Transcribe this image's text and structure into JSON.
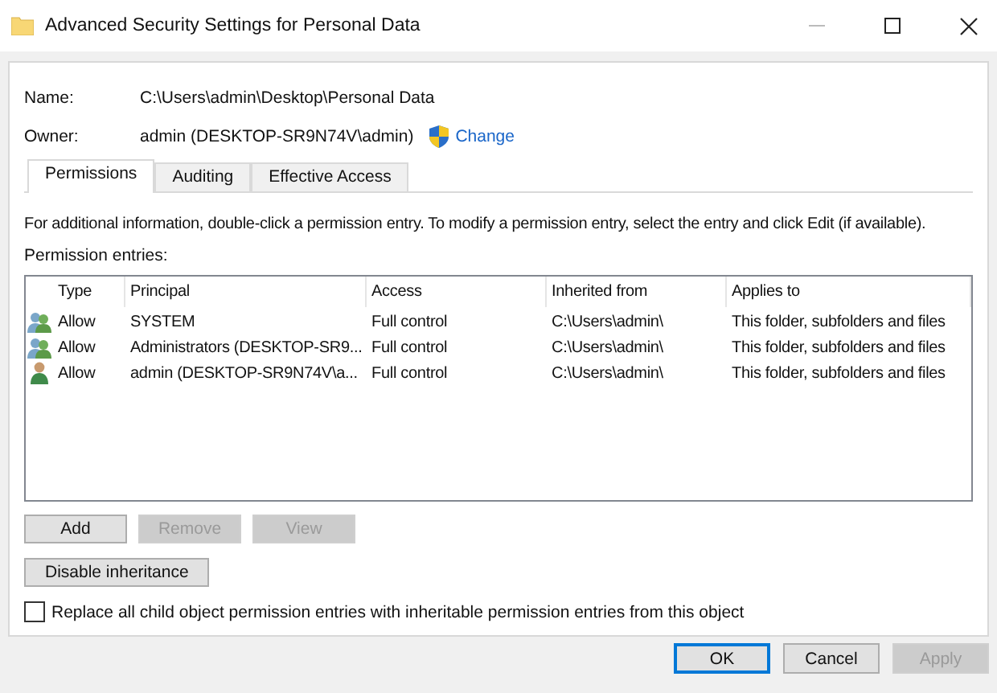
{
  "window": {
    "title": "Advanced Security Settings for Personal Data"
  },
  "name": {
    "label": "Name:",
    "value": "C:\\Users\\admin\\Desktop\\Personal Data"
  },
  "owner": {
    "label": "Owner:",
    "value": "admin (DESKTOP-SR9N74V\\admin)",
    "link": "Change"
  },
  "tabs": [
    {
      "label": "Permissions",
      "selected": true
    },
    {
      "label": "Auditing",
      "selected": false
    },
    {
      "label": "Effective Access",
      "selected": false
    }
  ],
  "info": "For additional information, double-click a permission entry. To modify a permission entry, select the entry and click Edit (if available).",
  "entries_label": "Permission entries:",
  "table": {
    "columns": [
      "Type",
      "Principal",
      "Access",
      "Inherited from",
      "Applies to"
    ],
    "rows": [
      {
        "kind": "group",
        "cells": [
          "Allow",
          "SYSTEM",
          "Full control",
          "C:\\Users\\admin\\",
          "This folder, subfolders and files"
        ]
      },
      {
        "kind": "group",
        "cells": [
          "Allow",
          "Administrators (DESKTOP-SR9...",
          "Full control",
          "C:\\Users\\admin\\",
          "This folder, subfolders and files"
        ]
      },
      {
        "kind": "user",
        "cells": [
          "Allow",
          "admin (DESKTOP-SR9N74V\\a...",
          "Full control",
          "C:\\Users\\admin\\",
          "This folder, subfolders and files"
        ]
      }
    ]
  },
  "entry_buttons": [
    {
      "label": "Add",
      "disabled": false
    },
    {
      "label": "Remove",
      "disabled": true
    },
    {
      "label": "View",
      "disabled": true
    }
  ],
  "inheritance_button": "Disable inheritance",
  "replace_checkbox": {
    "label": "Replace all child object permission entries with inheritable permission entries from this object",
    "checked": false
  },
  "dialog_buttons": [
    {
      "label": "OK",
      "disabled": false,
      "default": true
    },
    {
      "label": "Cancel",
      "disabled": false,
      "default": false
    },
    {
      "label": "Apply",
      "disabled": true,
      "default": false
    }
  ]
}
